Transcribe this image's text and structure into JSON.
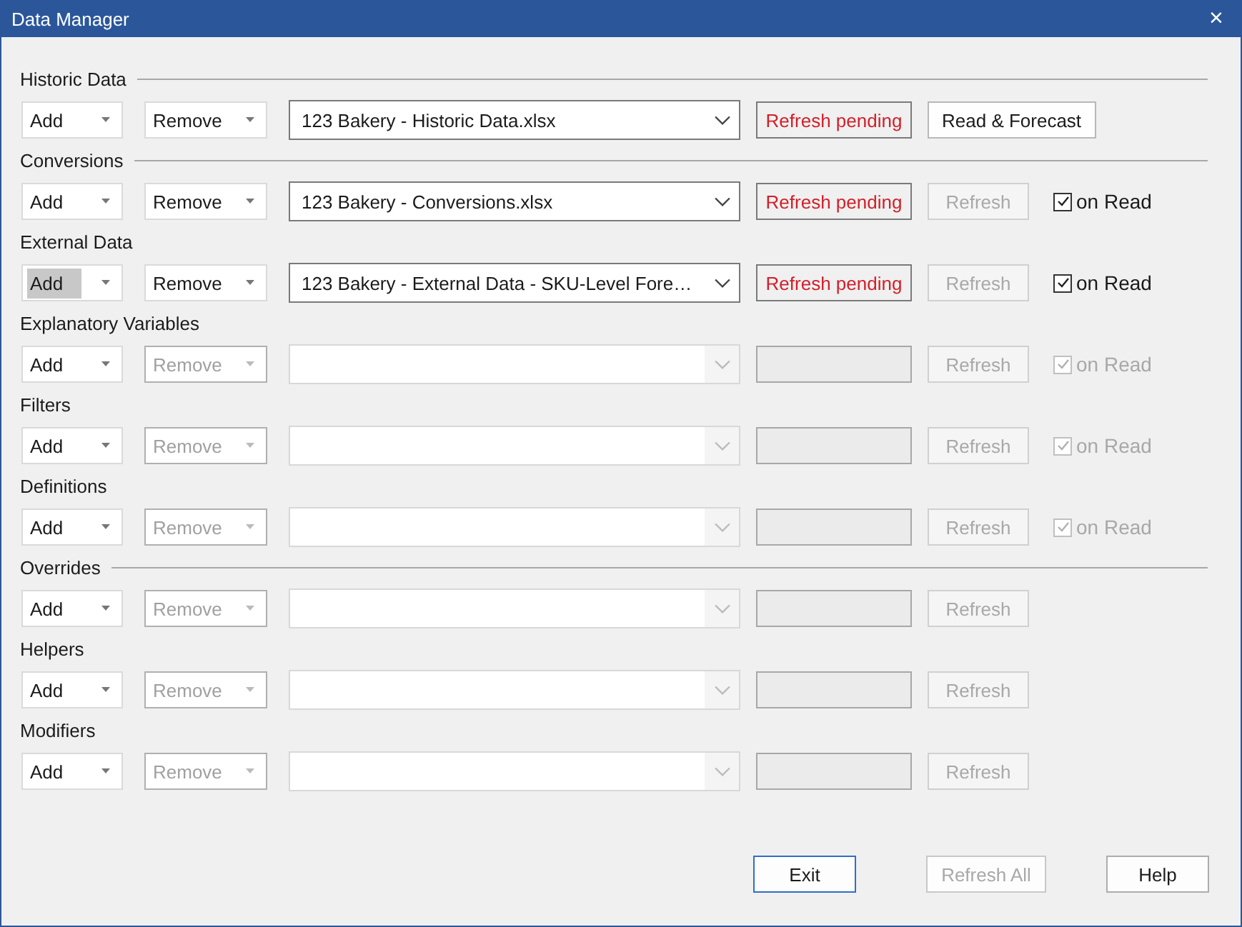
{
  "window": {
    "title": "Data Manager",
    "close": "×"
  },
  "sections": [
    {
      "title": "Historic Data",
      "divider": true,
      "add": {
        "label": "Add",
        "disabled": false,
        "focused": false
      },
      "remove": {
        "label": "Remove",
        "disabled": false
      },
      "file": {
        "value": "123 Bakery - Historic Data.xlsx",
        "disabled": false
      },
      "status": {
        "text": "Refresh pending",
        "disabled": false
      },
      "action": {
        "label": "Read & Forecast",
        "disabled": false
      }
    },
    {
      "title": "Conversions",
      "divider": true,
      "add": {
        "label": "Add",
        "disabled": false,
        "focused": false
      },
      "remove": {
        "label": "Remove",
        "disabled": false
      },
      "file": {
        "value": "123 Bakery - Conversions.xlsx",
        "disabled": false
      },
      "status": {
        "text": "Refresh pending",
        "disabled": false
      },
      "action": {
        "label": "Refresh",
        "disabled": true
      },
      "on_read": {
        "label": "on Read",
        "checked": true,
        "disabled": false
      }
    },
    {
      "title": "External Data",
      "divider": false,
      "add": {
        "label": "Add",
        "disabled": false,
        "focused": true
      },
      "remove": {
        "label": "Remove",
        "disabled": false
      },
      "file": {
        "value": "123 Bakery - External Data - SKU-Level Fore…",
        "disabled": false
      },
      "status": {
        "text": "Refresh pending",
        "disabled": false
      },
      "action": {
        "label": "Refresh",
        "disabled": true
      },
      "on_read": {
        "label": "on Read",
        "checked": true,
        "disabled": false
      }
    },
    {
      "title": "Explanatory Variables",
      "divider": false,
      "add": {
        "label": "Add",
        "disabled": false,
        "focused": false
      },
      "remove": {
        "label": "Remove",
        "disabled": true
      },
      "file": {
        "disabled": true
      },
      "status": {
        "disabled": true
      },
      "action": {
        "label": "Refresh",
        "disabled": true
      },
      "on_read": {
        "label": "on Read",
        "checked": true,
        "disabled": true
      }
    },
    {
      "title": "Filters",
      "divider": false,
      "add": {
        "label": "Add",
        "disabled": false,
        "focused": false
      },
      "remove": {
        "label": "Remove",
        "disabled": true
      },
      "file": {
        "disabled": true
      },
      "status": {
        "disabled": true
      },
      "action": {
        "label": "Refresh",
        "disabled": true
      },
      "on_read": {
        "label": "on Read",
        "checked": true,
        "disabled": true
      }
    },
    {
      "title": "Definitions",
      "divider": false,
      "add": {
        "label": "Add",
        "disabled": false,
        "focused": false
      },
      "remove": {
        "label": "Remove",
        "disabled": true
      },
      "file": {
        "disabled": true
      },
      "status": {
        "disabled": true
      },
      "action": {
        "label": "Refresh",
        "disabled": true
      },
      "on_read": {
        "label": "on Read",
        "checked": true,
        "disabled": true
      }
    },
    {
      "title": "Overrides",
      "divider": true,
      "add": {
        "label": "Add",
        "disabled": false,
        "focused": false
      },
      "remove": {
        "label": "Remove",
        "disabled": true
      },
      "file": {
        "disabled": true
      },
      "status": {
        "disabled": true
      },
      "action": {
        "label": "Refresh",
        "disabled": true
      }
    },
    {
      "title": "Helpers",
      "divider": false,
      "add": {
        "label": "Add",
        "disabled": false,
        "focused": false
      },
      "remove": {
        "label": "Remove",
        "disabled": true
      },
      "file": {
        "disabled": true
      },
      "status": {
        "disabled": true
      },
      "action": {
        "label": "Refresh",
        "disabled": true
      }
    },
    {
      "title": "Modifiers",
      "divider": false,
      "add": {
        "label": "Add",
        "disabled": false,
        "focused": false
      },
      "remove": {
        "label": "Remove",
        "disabled": true
      },
      "file": {
        "disabled": true
      },
      "status": {
        "disabled": true
      },
      "action": {
        "label": "Refresh",
        "disabled": true
      }
    }
  ],
  "footer": [
    {
      "label": "Exit",
      "disabled": false,
      "default": true
    },
    {
      "label": "Refresh All",
      "disabled": true,
      "default": false
    },
    {
      "label": "Help",
      "disabled": false,
      "default": false
    }
  ]
}
